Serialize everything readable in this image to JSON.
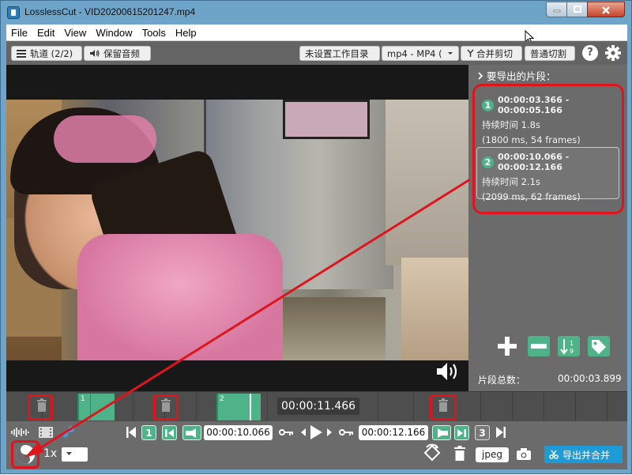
{
  "window": {
    "title": "LosslessCut - VID20200615201247.mp4"
  },
  "menu": [
    "File",
    "Edit",
    "View",
    "Window",
    "Tools",
    "Help"
  ],
  "toolbar": {
    "tracks_label": "轨道 (2/2)",
    "keep_audio_label": "保留音频",
    "workdir_label": "未设置工作目录",
    "format_label": "mp4 - MP4 (",
    "merge_label": "合并剪切",
    "cut_mode_label": "普通切割",
    "help_label": "?"
  },
  "segments_panel": {
    "header": "要导出的片段：",
    "segments": [
      {
        "num": "1",
        "range": "00:00:03.366 - 00:00:05.166",
        "duration": "持续时间 1.8s",
        "detail": "(1800 ms, 54 frames)"
      },
      {
        "num": "2",
        "range": "00:00:10.066 - 00:00:12.166",
        "duration": "持续时间 2.1s",
        "detail": "(2099 ms, 62 frames)"
      }
    ],
    "total_label": "片段总数：",
    "total_value": "00:00:03.899"
  },
  "timeline": {
    "current_time": "00:00:11.466",
    "segment_labels": [
      "1",
      "2"
    ]
  },
  "controls": {
    "seg_badge_1": "1",
    "seg_badge_3": "3",
    "cut_start": "00:00:10.066",
    "cut_end": "00:00:12.166",
    "speed": "1x",
    "snapshot_format": "jpeg",
    "export_label": "导出并合并"
  },
  "colors": {
    "segment_green": "#4fb389",
    "export_blue": "#1e9ad6",
    "annotation_red": "#e0141c",
    "panel_gray": "#6b6b6b"
  }
}
